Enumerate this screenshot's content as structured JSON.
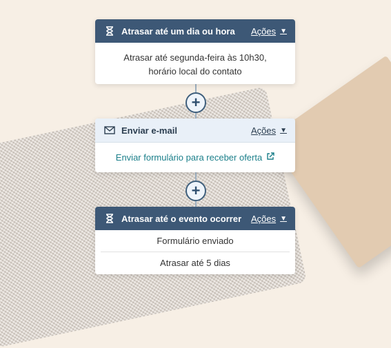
{
  "workflow": {
    "cards": [
      {
        "header": "Atrasar até um dia ou hora",
        "actions": "Ações",
        "body_lines": [
          "Atrasar até segunda-feira às 10h30,",
          "horário local do contato"
        ]
      },
      {
        "header": "Enviar e-mail",
        "actions": "Ações",
        "link_text": "Enviar formulário para receber oferta"
      },
      {
        "header": "Atrasar até o evento ocorrer",
        "actions": "Ações",
        "rows": [
          "Formulário enviado",
          "Atrasar até 5 dias"
        ]
      }
    ],
    "add_symbol": "+"
  },
  "colors": {
    "header_dark": "#3d5876",
    "header_light": "#e9f0f8",
    "link": "#1b7f8a"
  }
}
